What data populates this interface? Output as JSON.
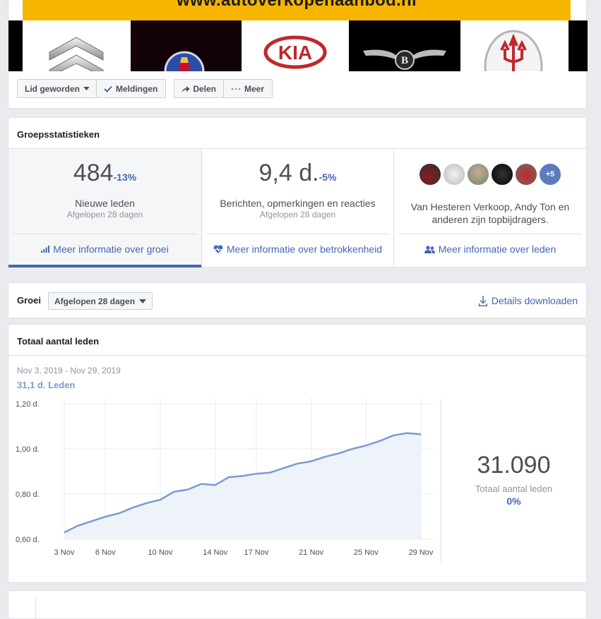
{
  "cover": {
    "banner_text": "www.autoverkopenaanbod.nl",
    "logos": [
      "Citroën",
      "Saab",
      "KIA",
      "Bentley",
      "Maserati"
    ],
    "kia_text": "KIA",
    "buttons": {
      "joined": "Lid geworden",
      "notifications": "Meldingen",
      "share": "Delen",
      "more": "Meer"
    }
  },
  "stats": {
    "title": "Groepsstatistieken",
    "new_members": {
      "value": "484",
      "delta": "-13%",
      "label": "Nieuwe leden",
      "period": "Afgelopen 28 dagen",
      "link": "Meer informatie over groei"
    },
    "posts": {
      "value": "9,4 d.",
      "delta": "-5%",
      "label": "Berichten, opmerkingen en reacties",
      "period": "Afgelopen 28 dagen",
      "link": "Meer informatie over betrokkenheid"
    },
    "contributors": {
      "more_count": "+5",
      "text_line1": "Van Hesteren Verkoop, Andy Ton en",
      "text_line2": "anderen zijn topbijdragers.",
      "link": "Meer informatie over leden"
    }
  },
  "growth": {
    "label": "Groei",
    "period": "Afgelopen 28 dagen",
    "download": "Details downloaden"
  },
  "chart_card": {
    "title": "Totaal aantal leden",
    "date_range": "Nov 3, 2019 - Nov 29, 2019",
    "series_label": "31,1 d. Leden",
    "total_value": "31.090",
    "total_label": "Totaal aantal leden",
    "total_delta": "0%"
  },
  "chart_data": {
    "type": "area",
    "title": "Totaal aantal leden",
    "x": [
      "3 Nov",
      "4 Nov",
      "5 Nov",
      "6 Nov",
      "7 Nov",
      "8 Nov",
      "9 Nov",
      "10 Nov",
      "11 Nov",
      "12 Nov",
      "13 Nov",
      "14 Nov",
      "15 Nov",
      "16 Nov",
      "17 Nov",
      "18 Nov",
      "19 Nov",
      "20 Nov",
      "21 Nov",
      "22 Nov",
      "23 Nov",
      "24 Nov",
      "25 Nov",
      "26 Nov",
      "27 Nov",
      "28 Nov",
      "29 Nov"
    ],
    "x_tick_labels": [
      "3 Nov",
      "6 Nov",
      "10 Nov",
      "14 Nov",
      "17 Nov",
      "21 Nov",
      "25 Nov",
      "29 Nov"
    ],
    "y_tick_labels": [
      "1,20 d.",
      "1,00 d.",
      "0,80 d.",
      "0,60 d."
    ],
    "y_tick_values": [
      30.85,
      30.65,
      30.45,
      30.25
    ],
    "ylim": [
      30.25,
      30.85
    ],
    "series": [
      {
        "values": [
          30.28,
          30.31,
          30.33,
          30.35,
          30.365,
          30.39,
          30.41,
          30.425,
          30.46,
          30.47,
          30.495,
          30.49,
          30.525,
          30.53,
          30.54,
          30.545,
          30.565,
          30.585,
          30.595,
          30.615,
          30.63,
          30.65,
          30.665,
          30.685,
          30.71,
          30.72,
          30.715
        ],
        "color": "#7b9bce"
      }
    ],
    "grid": true,
    "colors": {
      "line": "#7b9bce",
      "fill": "#eef2f9"
    }
  },
  "colors": {
    "link": "#4267b2",
    "active_tab": "#4267b2",
    "banner": "#f7b500"
  }
}
